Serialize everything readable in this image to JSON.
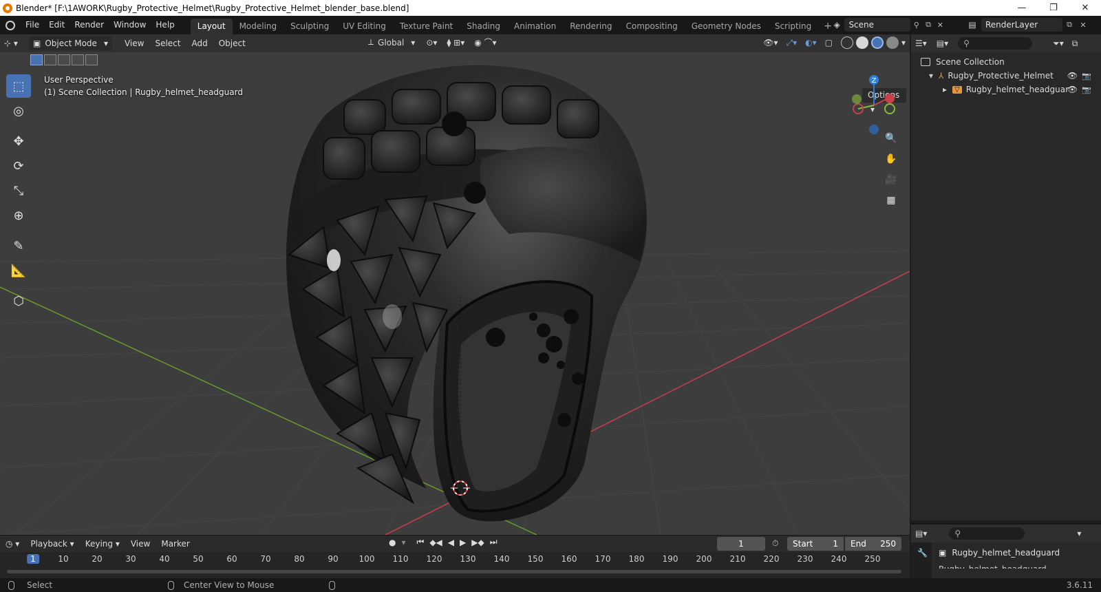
{
  "window": {
    "title": "Blender* [F:\\1AWORK\\Rugby_Protective_Helmet\\Rugby_Protective_Helmet_blender_base.blend]",
    "minimize": "—",
    "maximize": "❐",
    "close": "✕"
  },
  "menu": [
    "File",
    "Edit",
    "Render",
    "Window",
    "Help"
  ],
  "workspaces": [
    "Layout",
    "Modeling",
    "Sculpting",
    "UV Editing",
    "Texture Paint",
    "Shading",
    "Animation",
    "Rendering",
    "Compositing",
    "Geometry Nodes",
    "Scripting"
  ],
  "active_workspace": "Layout",
  "scene": {
    "name": "Scene"
  },
  "render_layer": {
    "name": "RenderLayer"
  },
  "viewport": {
    "mode": "Object Mode",
    "menus": [
      "View",
      "Select",
      "Add",
      "Object"
    ],
    "transform_orientation": "Global",
    "overlay_line1": "User Perspective",
    "overlay_line2": "(1) Scene Collection | Rugby_helmet_headguard",
    "options_label": "Options",
    "gizmo_z": "Z"
  },
  "outliner": {
    "root": "Scene Collection",
    "items": [
      {
        "label": "Rugby_Protective_Helmet",
        "depth": 1
      },
      {
        "label": "Rugby_helmet_headguar",
        "depth": 2
      }
    ]
  },
  "properties": {
    "object_name": "Rugby_helmet_headguard",
    "partial_row": "Rugby_helmet_headguard"
  },
  "timeline": {
    "menus": [
      "Playback",
      "Keying",
      "View",
      "Marker"
    ],
    "current_frame": "1",
    "start_label": "Start",
    "start_value": "1",
    "end_label": "End",
    "end_value": "250",
    "ticks": [
      "1",
      "10",
      "20",
      "30",
      "40",
      "50",
      "60",
      "70",
      "80",
      "90",
      "100",
      "110",
      "120",
      "130",
      "140",
      "150",
      "160",
      "170",
      "180",
      "190",
      "200",
      "210",
      "220",
      "230",
      "240",
      "250"
    ]
  },
  "status": {
    "select": "Select",
    "center_view": "Center View to Mouse",
    "version": "3.6.11"
  },
  "colors": {
    "accent": "#4772b3",
    "viewport_bg": "#3d3d3d",
    "axis_x": "#c8404a",
    "axis_y": "#6a9a2a",
    "object_orange": "#e6963c"
  }
}
